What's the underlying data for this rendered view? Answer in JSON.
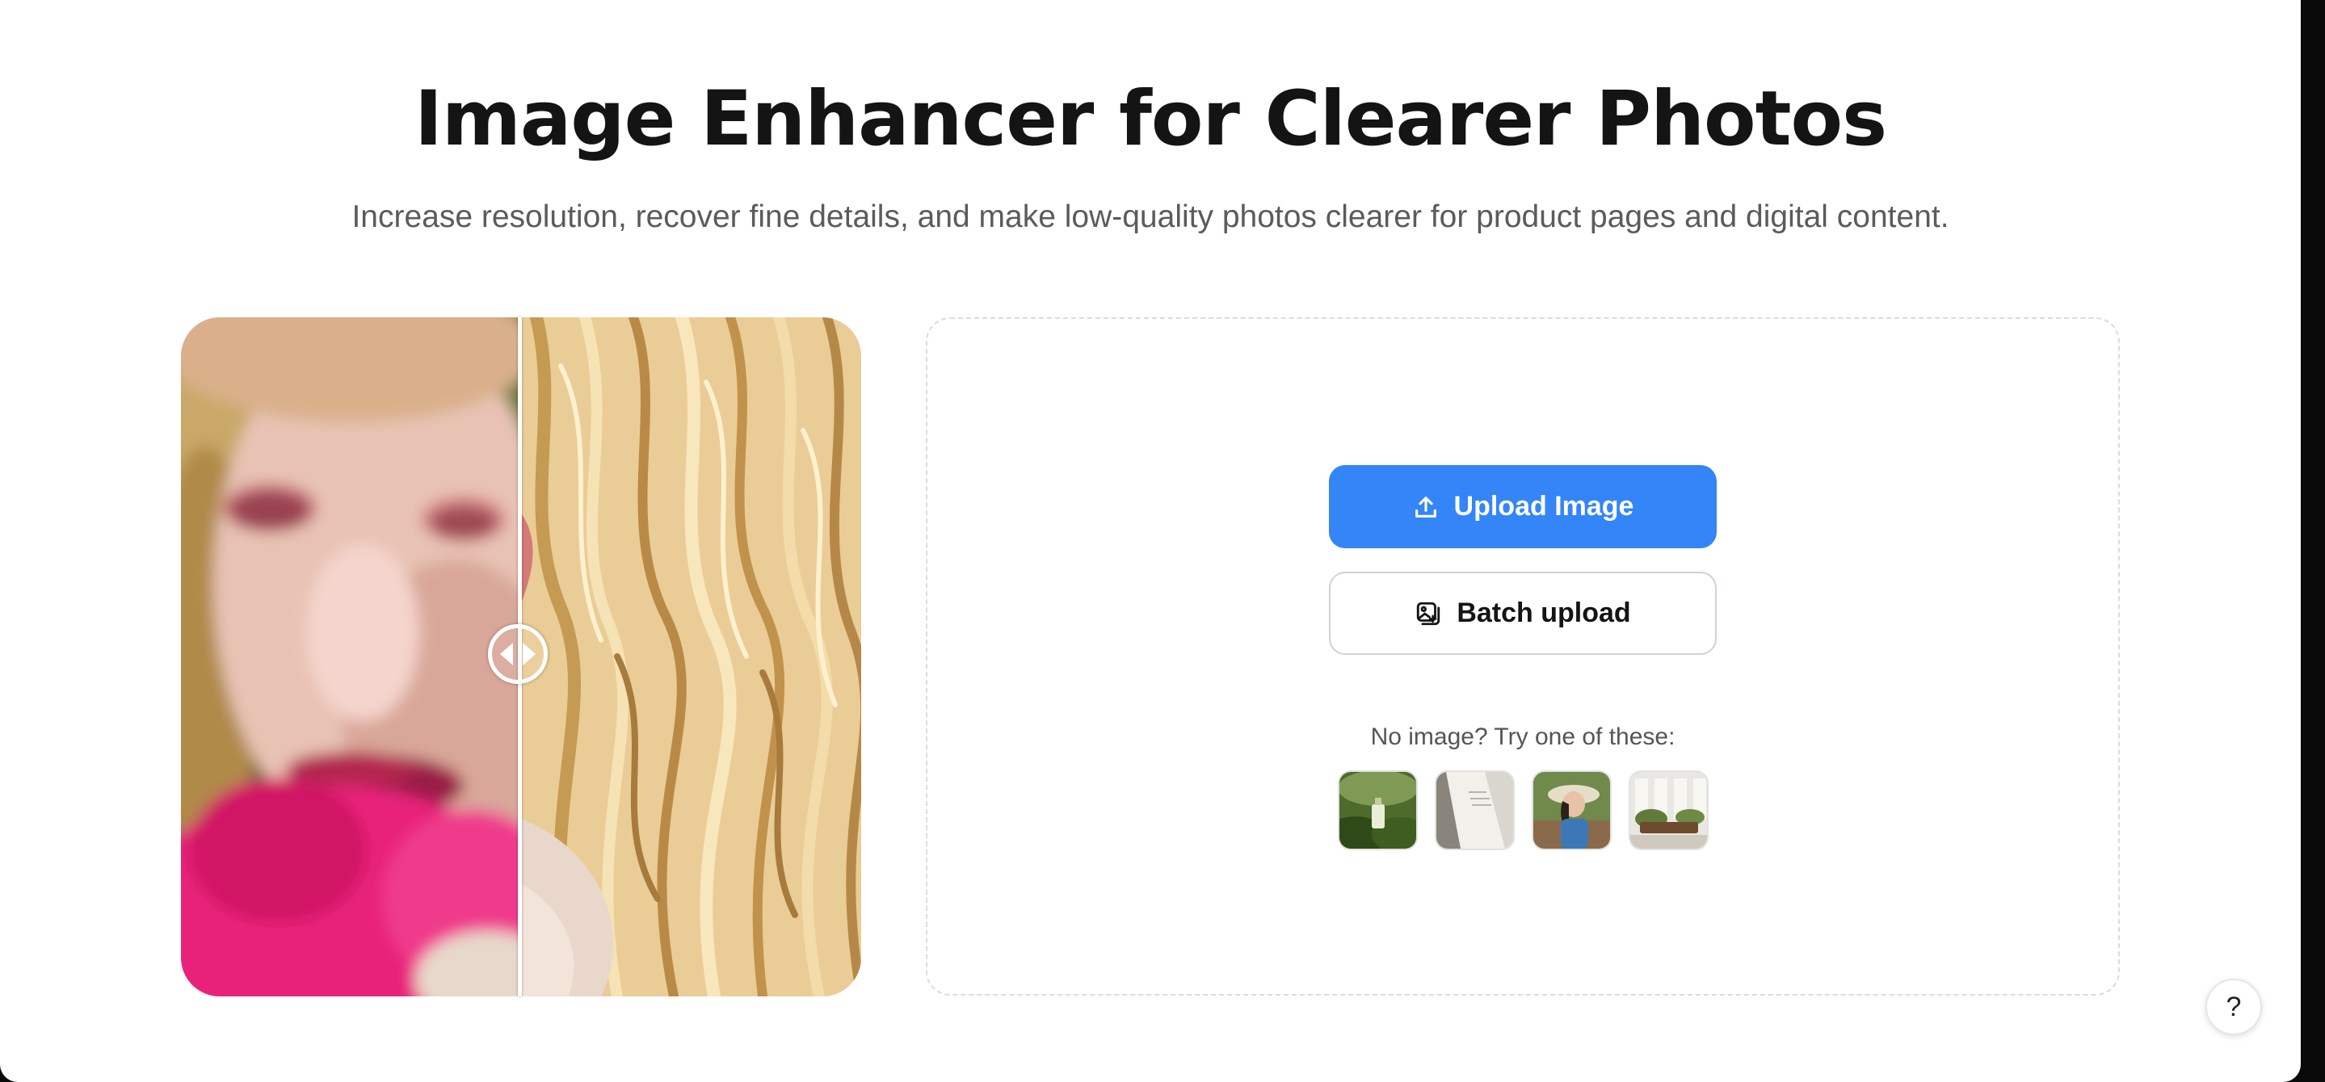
{
  "header": {
    "title": "Image Enhancer for Clearer Photos",
    "subtitle": "Increase resolution, recover fine details, and make low-quality photos clearer for product pages and digital content."
  },
  "comparison": {
    "before_label": "blurry portrait",
    "after_label": "enhanced portrait",
    "handle_icon": "left-right-arrows-icon",
    "split_fraction": 0.5
  },
  "upload": {
    "upload_label": "Upload Image",
    "upload_icon": "upload-icon",
    "batch_label": "Batch upload",
    "batch_icon": "images-stack-icon",
    "accent_color": "#3385f8"
  },
  "samples": {
    "prompt": "No image? Try one of these:",
    "items": [
      {
        "name": "perfume bottle on moss"
      },
      {
        "name": "open book page"
      },
      {
        "name": "woman with sun hat"
      },
      {
        "name": "living room interior"
      }
    ]
  },
  "help": {
    "label": "?"
  }
}
